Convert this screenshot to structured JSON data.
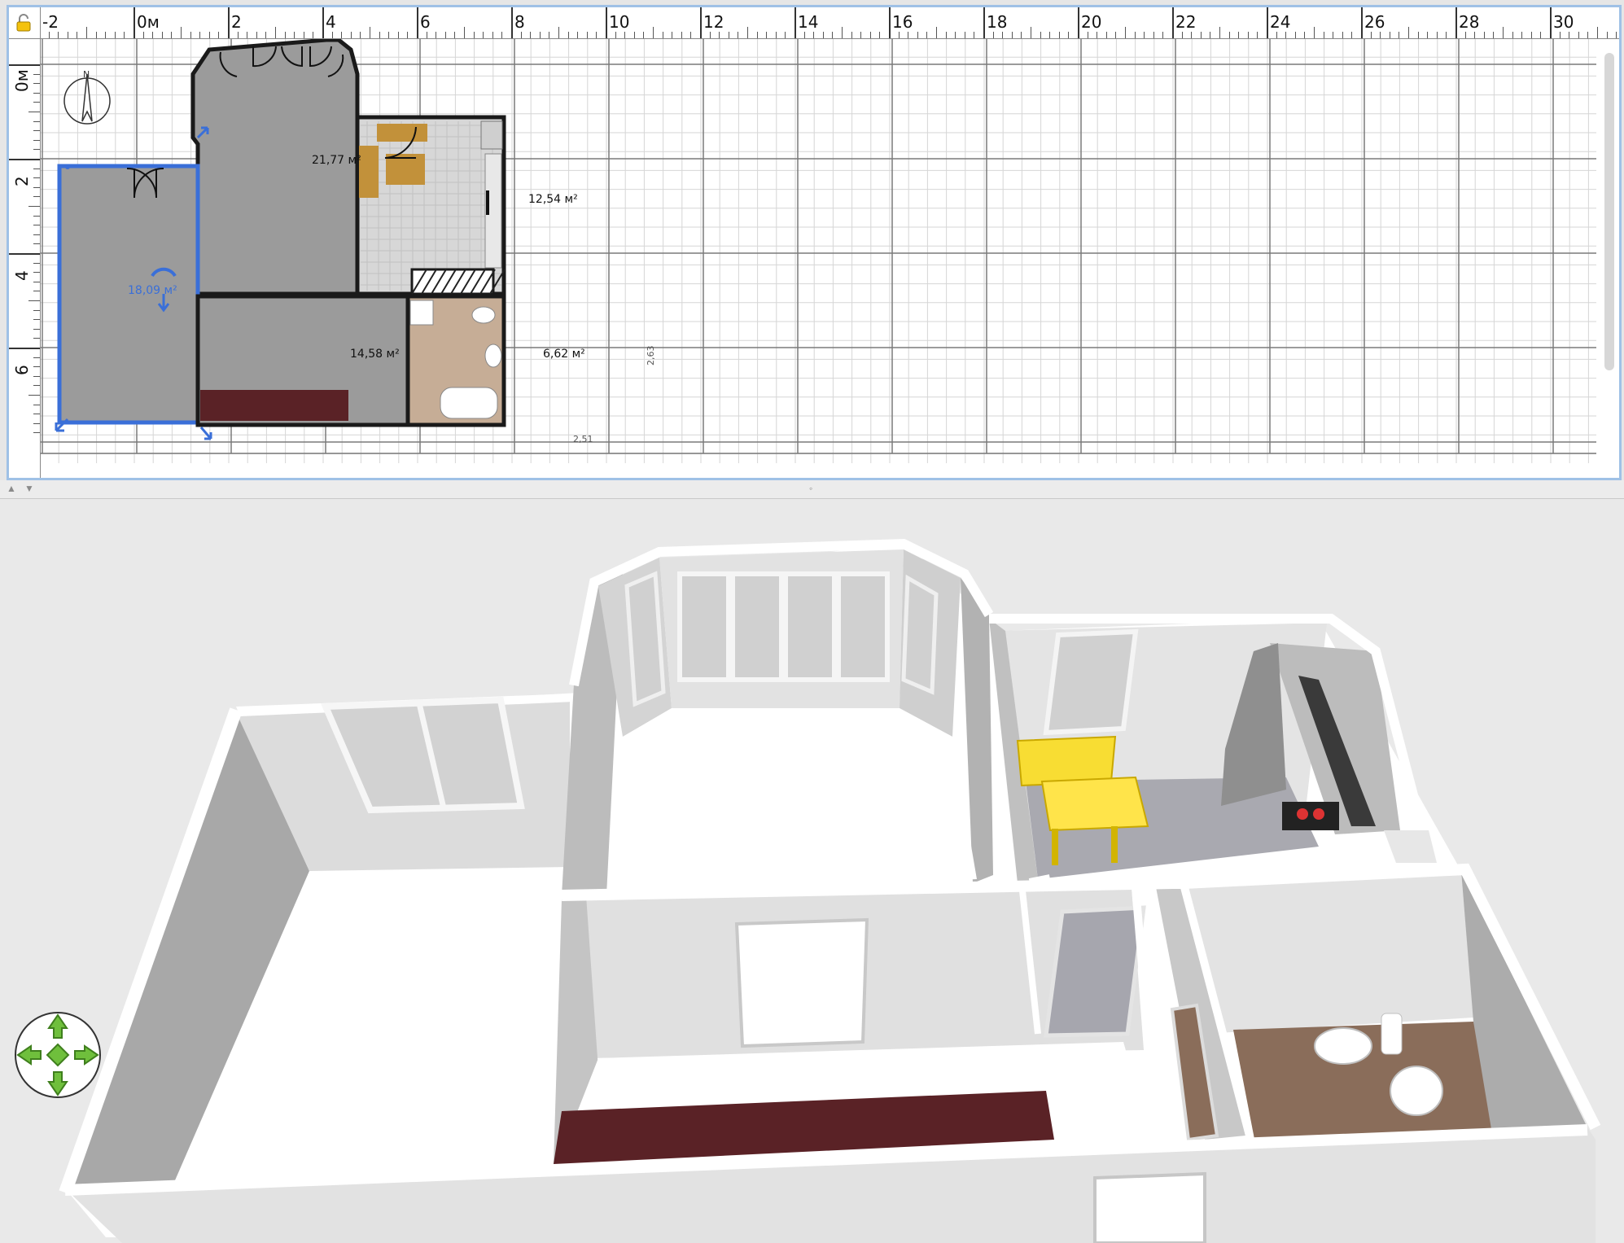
{
  "plan": {
    "ruler_top_labels": [
      "-2",
      "0м",
      "2",
      "4",
      "6",
      "8",
      "10",
      "12",
      "14",
      "16",
      "18",
      "20",
      "22",
      "24",
      "26",
      "28",
      "30"
    ],
    "ruler_left_labels": [
      "0м",
      "2",
      "4",
      "6"
    ],
    "rooms": [
      {
        "id": "room-bedroom",
        "area": "18,09 м²",
        "selected": true
      },
      {
        "id": "room-living",
        "area": "21,77 м²"
      },
      {
        "id": "room-kitchen",
        "area": "12,54 м²"
      },
      {
        "id": "room-hall",
        "area": "14,58 м²"
      },
      {
        "id": "room-bathroom",
        "area": "6,62 м²"
      }
    ],
    "dimensions": {
      "bathroom_width": "2,51",
      "bathroom_depth": "2,63"
    },
    "compass_letter": "N"
  },
  "view3d": {
    "navigation_widget": "navigation-arrows"
  },
  "colors": {
    "selection": "#3a6fd8",
    "room_fill": "#9b9b9b",
    "panel_border": "#9fc1e6",
    "carpet": "#5a2226",
    "kitchen_furniture": "#ffe44a",
    "nav_green": "#6fbf3c"
  }
}
